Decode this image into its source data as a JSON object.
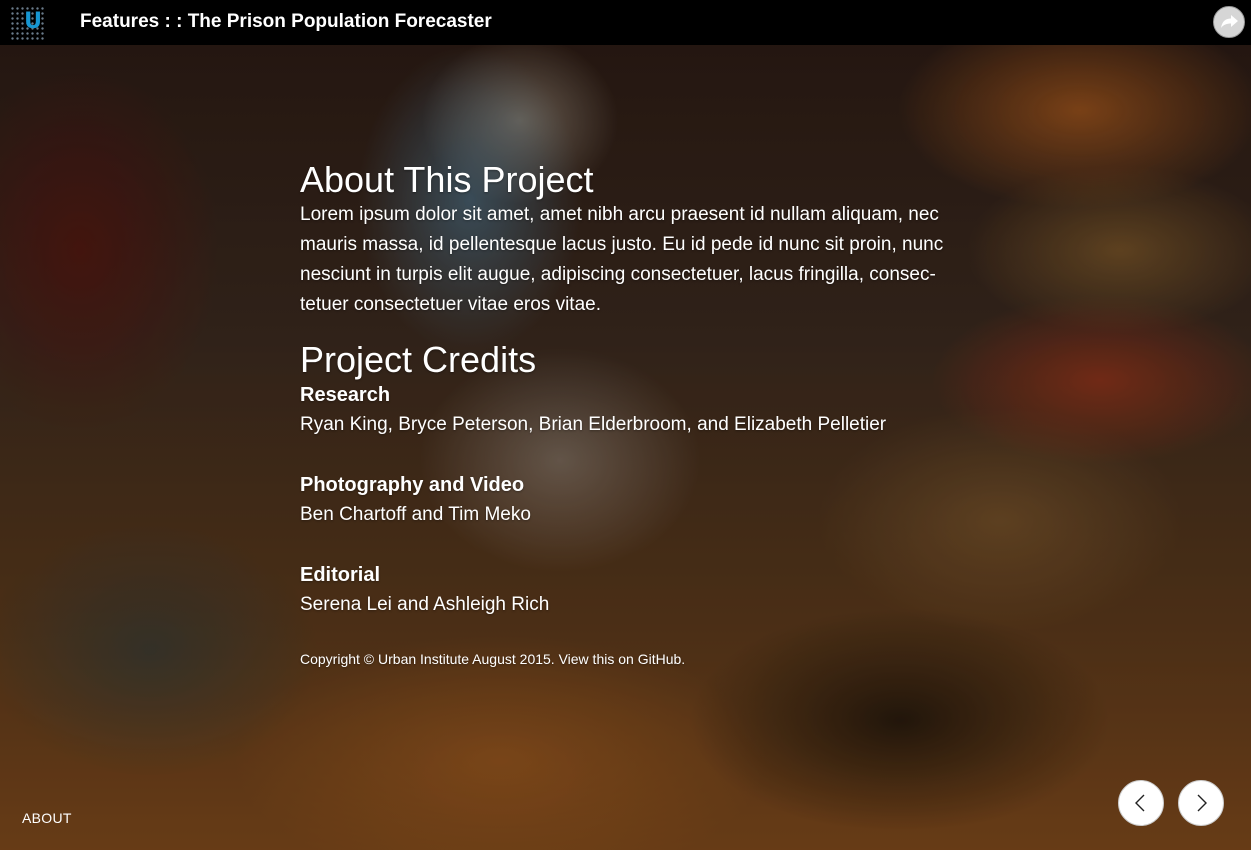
{
  "header": {
    "logo_letter": "U",
    "title": "Features : : The Prison Population Forecaster",
    "share_icon": "share-icon"
  },
  "about": {
    "heading": "About This Project",
    "body": "Lorem ipsum dolor sit amet, amet nibh arcu praesent id nullam aliquam, nec mauris massa, id pellentesque lacus justo. Eu id pede id nunc sit proin, nunc nesciunt in turpis elit augue, adipiscing consectetuer, lacus fringilla, consec-tetuer consectetuer vitae eros vitae."
  },
  "credits": {
    "heading": "Project Credits",
    "groups": [
      {
        "role": "Research",
        "names": "Ryan King, Bryce Peterson, Brian Elderbroom, and Elizabeth Pelletier"
      },
      {
        "role": "Photography and Video",
        "names": "Ben Chartoff and Tim Meko"
      },
      {
        "role": "Editorial",
        "names": "Serena Lei and Ashleigh Rich"
      }
    ]
  },
  "copyright": {
    "text": "Copyright © Urban Institute August 2015. ",
    "link": "View this on GitHub."
  },
  "footer": {
    "section_label": "ABOUT",
    "prev_icon": "chevron-left-icon",
    "next_icon": "chevron-right-icon"
  },
  "colors": {
    "brand_blue": "#1696d2",
    "topbar": "#000000",
    "text": "#ffffff"
  }
}
